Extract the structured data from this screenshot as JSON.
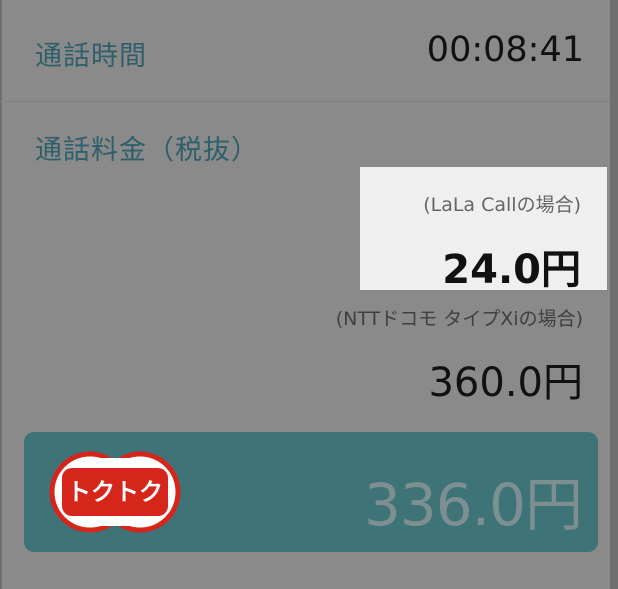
{
  "call_summary": {
    "duration_label": "通話時間",
    "duration_value": "00:08:41",
    "fee_label": "通話料金（税抜）"
  },
  "lala_call": {
    "caption": "(LaLa Callの場合)",
    "price": "24.0円"
  },
  "ntt_docomo": {
    "caption": "(NTTドコモ タイプXiの場合)",
    "price": "360.0円"
  },
  "savings": {
    "badge_text": "トクトク",
    "amount": "336.0円",
    "badge_color": "#d6251a",
    "card_color": "#3e7378"
  }
}
